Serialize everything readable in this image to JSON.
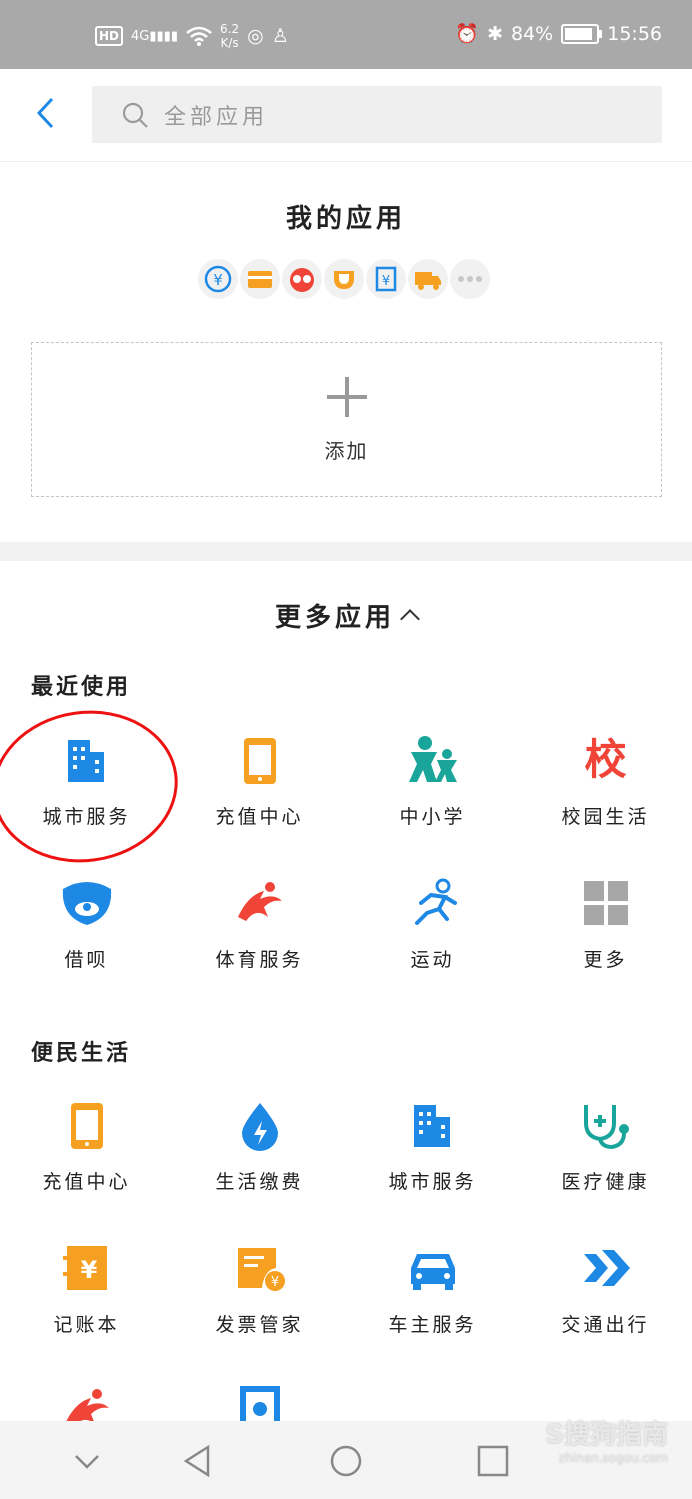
{
  "status": {
    "hd": "HD",
    "net": "4G",
    "speed_top": "6.2",
    "speed_bottom": "K/s",
    "battery": "84%",
    "time": "15:56"
  },
  "search": {
    "placeholder": "全部应用"
  },
  "my_apps": {
    "title": "我的应用",
    "add_label": "添加",
    "icons": [
      "yuan-swap-icon",
      "card-icon",
      "glasses-face-icon",
      "cup-icon",
      "receipt-yuan-icon",
      "truck-icon",
      "more-dots-icon"
    ]
  },
  "more_apps": {
    "title": "更多应用",
    "recent": {
      "title": "最近使用",
      "items": [
        {
          "label": "城市服务",
          "icon": "building-icon"
        },
        {
          "label": "充值中心",
          "icon": "phone-icon"
        },
        {
          "label": "中小学",
          "icon": "kids-icon"
        },
        {
          "label": "校园生活",
          "icon": "campus-icon",
          "glyph": "校"
        },
        {
          "label": "借呗",
          "icon": "jiebei-icon"
        },
        {
          "label": "体育服务",
          "icon": "sports-icon"
        },
        {
          "label": "运动",
          "icon": "runner-icon"
        },
        {
          "label": "更多",
          "icon": "grid-icon"
        }
      ]
    },
    "life": {
      "title": "便民生活",
      "items": [
        {
          "label": "充值中心",
          "icon": "phone-icon"
        },
        {
          "label": "生活缴费",
          "icon": "drop-bolt-icon"
        },
        {
          "label": "城市服务",
          "icon": "building-icon"
        },
        {
          "label": "医疗健康",
          "icon": "stethoscope-icon"
        },
        {
          "label": "记账本",
          "icon": "ledger-icon"
        },
        {
          "label": "发票管家",
          "icon": "invoice-icon"
        },
        {
          "label": "车主服务",
          "icon": "car-icon"
        },
        {
          "label": "交通出行",
          "icon": "arrows-icon"
        }
      ]
    }
  },
  "watermark": {
    "main": "S搜狗指南",
    "sub": "zhinan.sogou.com"
  },
  "colors": {
    "blue": "#1e88e5",
    "orange": "#f5a020",
    "red": "#f04438",
    "teal": "#1aa59b",
    "gray": "#a7a7a7"
  }
}
